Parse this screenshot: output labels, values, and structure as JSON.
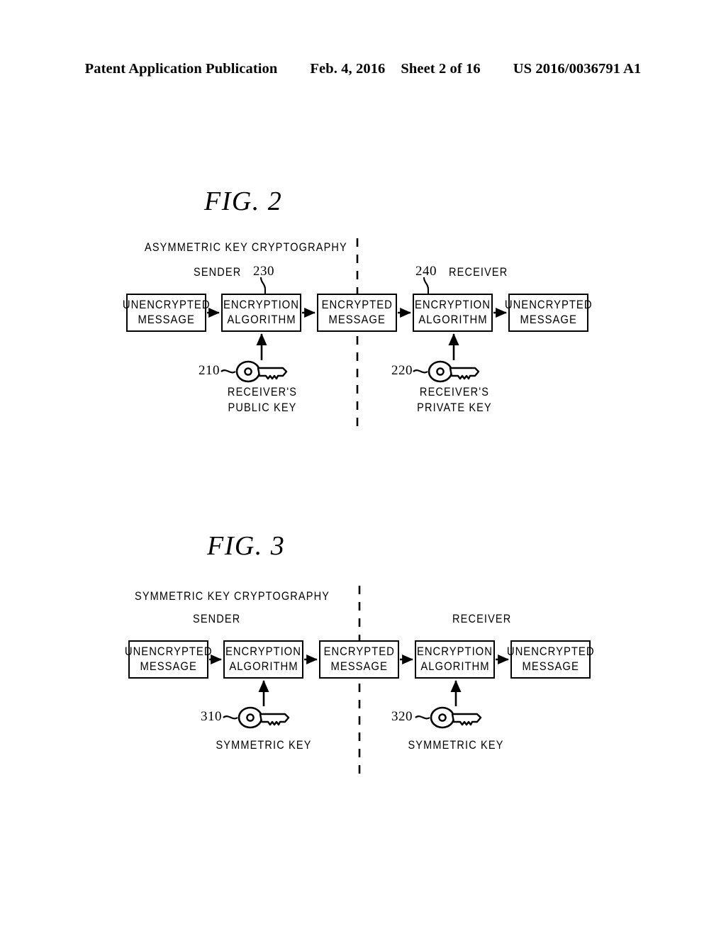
{
  "header": {
    "publication": "Patent Application Publication",
    "date": "Feb. 4, 2016",
    "sheet": "Sheet 2 of 16",
    "number": "US 2016/0036791 A1"
  },
  "figures": [
    {
      "id": "fig2",
      "title": "FIG. 2",
      "scheme_label": "ASYMMETRIC KEY CRYPTOGRAPHY",
      "sender_label": "SENDER",
      "receiver_label": "RECEIVER",
      "sender_ref": "230",
      "receiver_ref": "240",
      "boxes": [
        {
          "line1": "UNENCRYPTED",
          "line2": "MESSAGE"
        },
        {
          "line1": "ENCRYPTION",
          "line2": "ALGORITHM"
        },
        {
          "line1": "ENCRYPTED",
          "line2": "MESSAGE"
        },
        {
          "line1": "ENCRYPTION",
          "line2": "ALGORITHM"
        },
        {
          "line1": "UNENCRYPTED",
          "line2": "MESSAGE"
        }
      ],
      "keys": [
        {
          "ref": "210",
          "line1": "RECEIVER'S",
          "line2": "PUBLIC KEY"
        },
        {
          "ref": "220",
          "line1": "RECEIVER'S",
          "line2": "PRIVATE KEY"
        }
      ]
    },
    {
      "id": "fig3",
      "title": "FIG. 3",
      "scheme_label": "SYMMETRIC KEY CRYPTOGRAPHY",
      "sender_label": "SENDER",
      "receiver_label": "RECEIVER",
      "sender_ref": "",
      "receiver_ref": "",
      "boxes": [
        {
          "line1": "UNENCRYPTED",
          "line2": "MESSAGE"
        },
        {
          "line1": "ENCRYPTION",
          "line2": "ALGORITHM"
        },
        {
          "line1": "ENCRYPTED",
          "line2": "MESSAGE"
        },
        {
          "line1": "ENCRYPTION",
          "line2": "ALGORITHM"
        },
        {
          "line1": "UNENCRYPTED",
          "line2": "MESSAGE"
        }
      ],
      "keys": [
        {
          "ref": "310",
          "line1": "SYMMETRIC KEY",
          "line2": ""
        },
        {
          "ref": "320",
          "line1": "SYMMETRIC KEY",
          "line2": ""
        }
      ]
    }
  ],
  "colors": {
    "ink": "#000000",
    "paper": "#ffffff"
  }
}
